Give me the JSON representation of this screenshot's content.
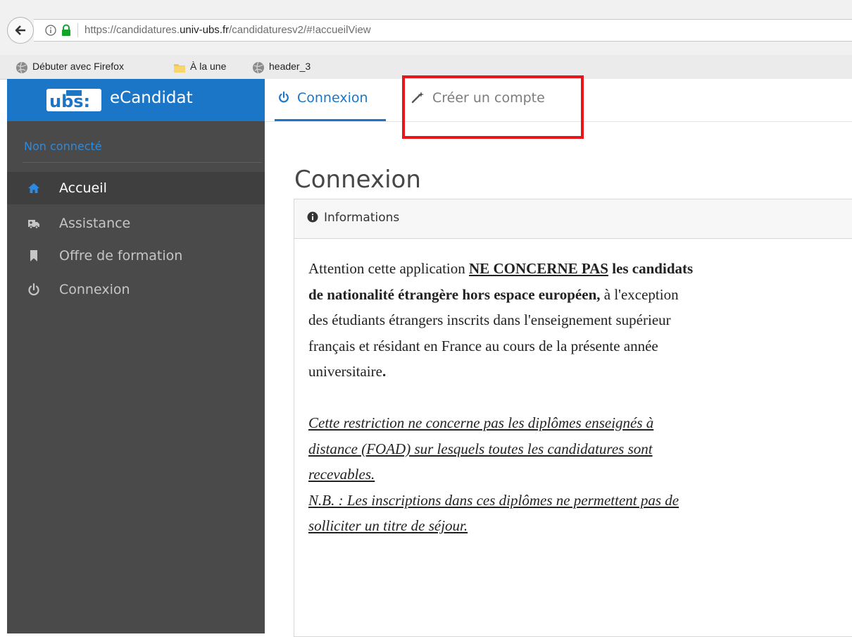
{
  "browser": {
    "url_prefix": "https://candidatures.",
    "url_domain": "univ-ubs.fr",
    "url_path": "/candidaturesv2/#!accueilView",
    "bookmarks": [
      {
        "label": "Débuter avec Firefox",
        "icon": "globe-icon"
      },
      {
        "label": "À la une",
        "icon": "folder-icon"
      },
      {
        "label": "header_3",
        "icon": "globe-icon"
      }
    ]
  },
  "app": {
    "logo_text": "ubs:",
    "title": "eCandidat"
  },
  "sidebar": {
    "status": "Non connecté",
    "items": [
      {
        "label": "Accueil",
        "icon": "home-icon",
        "active": true
      },
      {
        "label": "Assistance",
        "icon": "ambulance-icon",
        "active": false
      },
      {
        "label": "Offre de formation",
        "icon": "bookmark-icon",
        "active": false
      },
      {
        "label": "Connexion",
        "icon": "power-icon",
        "active": false
      }
    ]
  },
  "tabs": [
    {
      "label": "Connexion",
      "icon": "power-icon",
      "active": true
    },
    {
      "label": "Créer un compte",
      "icon": "magic-wand-icon",
      "active": false
    }
  ],
  "page": {
    "title": "Connexion"
  },
  "panel": {
    "title": "Informations",
    "line1_a": "Attention cette application ",
    "line1_b": "NE CONCERNE PAS",
    "line1_c": "  les candidats",
    "line2_a": "de nationalité étrangère hors espace européen,",
    "line2_b": " à l'exception",
    "line3": "des étudiants étrangers inscrits dans l'enseignement supérieur",
    "line4": "français et résidant en France au cours de la présente année",
    "line5_a": "universitaire",
    "line5_b": ".",
    "note1": "Cette restriction ne concerne pas les diplômes enseignés à",
    "note2": "distance (FOAD) sur lesquels toutes les candidatures sont",
    "note3": "recevables.",
    "note4": "N.B. : Les inscriptions dans ces diplômes ne permettent pas de",
    "note5": "solliciter un titre de séjour."
  },
  "colors": {
    "brand": "#1c76c7",
    "sidebar_bg": "#4a4a4a",
    "highlight": "#e8161b"
  }
}
